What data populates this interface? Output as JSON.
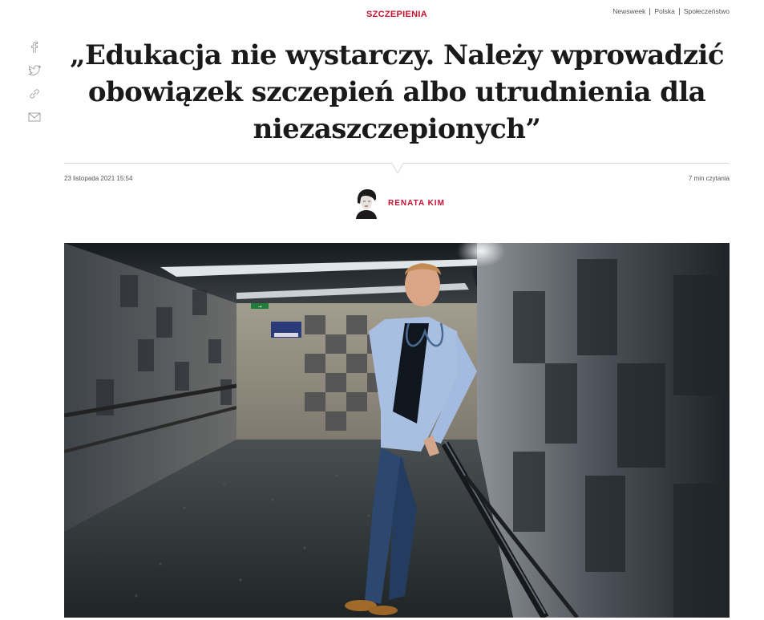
{
  "header": {
    "category": "SZCZEPIENIA",
    "breadcrumb": [
      "Newsweek",
      "Polska",
      "Społeczeństwo"
    ]
  },
  "share": [
    {
      "icon": "facebook-icon"
    },
    {
      "icon": "twitter-icon"
    },
    {
      "icon": "link-icon"
    },
    {
      "icon": "mail-icon"
    }
  ],
  "article": {
    "title_lines": [
      "„Edukacja nie wystarczy. Należy wprowadzić",
      "obowiązek szczepień albo utrudnienia dla",
      "niezaszczepionych”"
    ],
    "date": "23 listopada 2021 15:54",
    "read_time": "7 min czytania",
    "author": "RENATA KIM"
  },
  "hero_sign": {
    "exit_label": "→"
  },
  "colors": {
    "accent": "#c8102e",
    "text": "#1a1a1a",
    "muted": "#555555",
    "divider": "#d9d9d9"
  }
}
